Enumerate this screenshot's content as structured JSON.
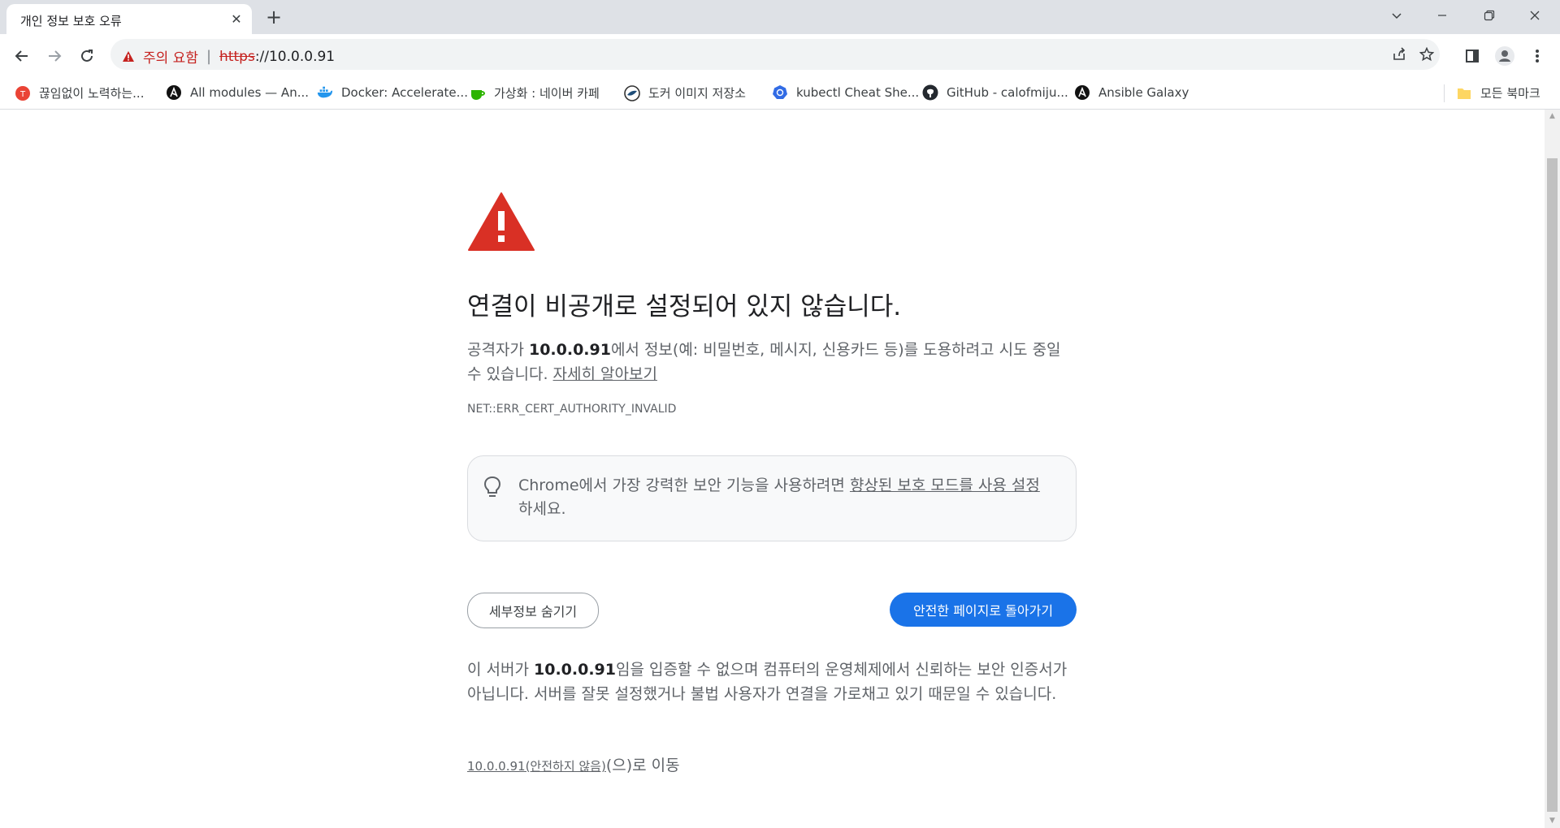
{
  "tab": {
    "title": "개인 정보 보호 오류",
    "close": "✕",
    "new_tab": "+"
  },
  "window": {
    "minimize": "—",
    "restore": "❐",
    "close": "✕"
  },
  "omnibox": {
    "security_label": "주의 요함",
    "separator": "|",
    "url_scheme": "https",
    "url_rest": "://10.0.0.91"
  },
  "bookmarks": {
    "items": [
      {
        "label": "끊임없이 노력하는...",
        "icon": "red-circle-icon"
      },
      {
        "label": "All modules — An...",
        "icon": "ansible-icon"
      },
      {
        "label": "Docker: Accelerate...",
        "icon": "docker-icon"
      },
      {
        "label": "가상화 : 네이버 카페",
        "icon": "naver-cafe-icon"
      },
      {
        "label": "도커 이미지 저장소",
        "icon": "registry-icon"
      },
      {
        "label": "kubectl Cheat She...",
        "icon": "kubernetes-icon"
      },
      {
        "label": "GitHub - calofmiju...",
        "icon": "github-icon"
      },
      {
        "label": "Ansible Galaxy",
        "icon": "ansible-icon"
      }
    ],
    "all_bookmarks": "모든 북마크"
  },
  "interstitial": {
    "heading": "연결이 비공개로 설정되어 있지 않습니다.",
    "explanation_prefix": "공격자가 ",
    "host": "10.0.0.91",
    "explanation_suffix": "에서 정보(예: 비밀번호, 메시지, 신용카드 등)를 도용하려고 시도 중일 수 있습니다. ",
    "learn_more": "자세히 알아보기",
    "error_code": "NET::ERR_CERT_AUTHORITY_INVALID",
    "tip_prefix": "Chrome에서 가장 강력한 보안 기능을 사용하려면 ",
    "tip_link": "향상된 보호 모드를 사용 설정",
    "tip_suffix": "하세요.",
    "hide_details_button": "세부정보 숨기기",
    "back_to_safety_button": "안전한 페이지로 돌아가기",
    "details_prefix": "이 서버가 ",
    "details_suffix": "임을 입증할 수 없으며 컴퓨터의 운영체제에서 신뢰하는 보안 인증서가 아닙니다. 서버를 잘못 설정했거나 불법 사용자가 연결을 가로채고 있기 때문일 수 있습니다.",
    "proceed_link": "10.0.0.91(안전하지 않음)",
    "proceed_suffix": "(으)로 이동"
  },
  "colors": {
    "warning_red": "#d93025",
    "button_blue": "#1a73e8",
    "tab_strip": "#dee1e6"
  }
}
